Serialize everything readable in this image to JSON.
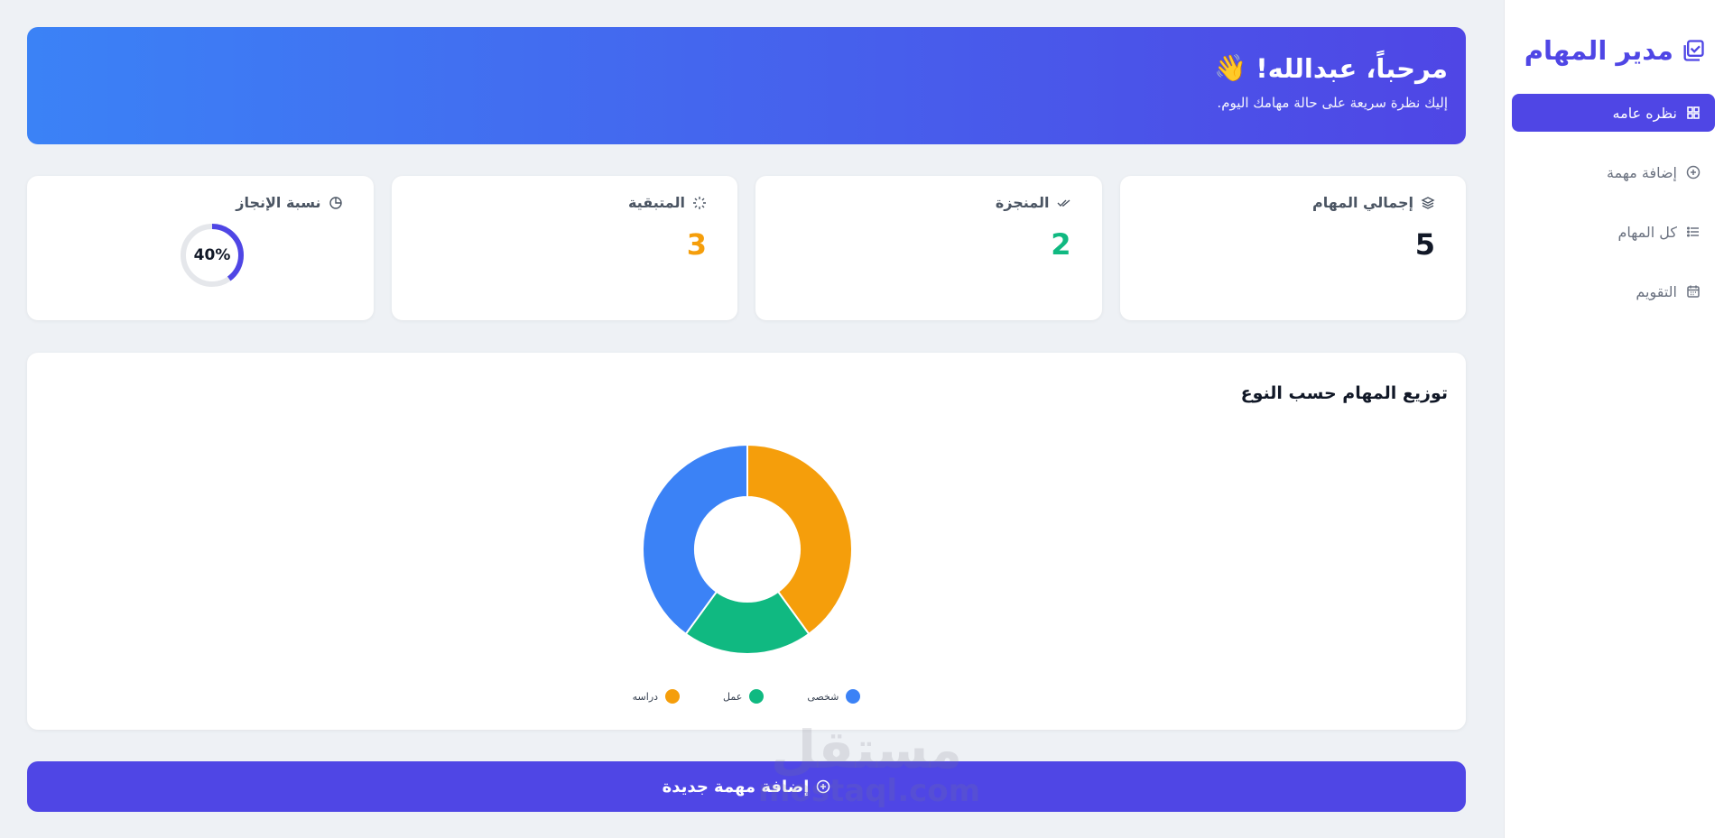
{
  "sidebar": {
    "brand": "مدير المهام",
    "items": [
      {
        "label": "نظره عامه",
        "icon": "grid-icon",
        "active": true
      },
      {
        "label": "إضافة مهمة",
        "icon": "plus-circle-icon",
        "active": false
      },
      {
        "label": "كل المهام",
        "icon": "list-icon",
        "active": false
      },
      {
        "label": "التقويم",
        "icon": "calendar-icon",
        "active": false
      }
    ]
  },
  "hero": {
    "title": "مرحباً، عبدالله!",
    "emoji": "👋",
    "subtitle": "إليك نظرة سريعة على حالة مهامك اليوم."
  },
  "stats": {
    "total": {
      "label": "إجمالي المهام",
      "value": "5"
    },
    "done": {
      "label": "المنجزة",
      "value": "2"
    },
    "remaining": {
      "label": "المتبقية",
      "value": "3"
    },
    "completion": {
      "label": "نسبة الإنجاز",
      "value": "40%",
      "fraction": 0.4
    }
  },
  "chart_data": {
    "type": "pie",
    "title": "توزيع المهام حسب النوع",
    "categories": [
      "شخصى",
      "عمل",
      "دراسه"
    ],
    "values": [
      2,
      1,
      2
    ],
    "colors": [
      "#3b82f6",
      "#10b981",
      "#f59e0b"
    ],
    "donut": true,
    "legend": "bottom"
  },
  "add_button": {
    "label": "إضافة مهمة جديدة"
  },
  "watermark": {
    "big": "مستقل",
    "small": "mostaql.com"
  },
  "colors": {
    "primary": "#4f46e5",
    "accent": "#3b82f6",
    "success": "#10b981",
    "warning": "#f59e0b"
  }
}
